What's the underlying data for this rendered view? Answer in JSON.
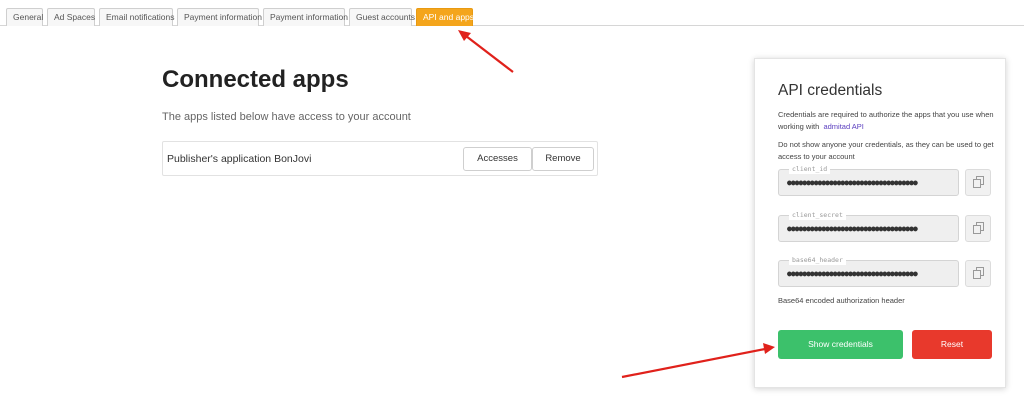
{
  "tabs": [
    {
      "label": "General",
      "active": false
    },
    {
      "label": "Ad Spaces",
      "active": false
    },
    {
      "label": "Email notifications",
      "active": false
    },
    {
      "label": "Payment information",
      "active": false
    },
    {
      "label": "Payment information",
      "active": false
    },
    {
      "label": "Guest accounts",
      "active": false
    },
    {
      "label": "API and apps",
      "active": true
    }
  ],
  "connected_apps": {
    "title": "Connected apps",
    "subtitle": "The apps listed below have access to your account",
    "app_name": "Publisher's application BonJovi",
    "accesses_label": "Accesses",
    "remove_label": "Remove"
  },
  "api_credentials": {
    "title": "API credentials",
    "description": "Credentials are required to authorize the apps that you use when working with",
    "description_link": "admitad API",
    "warning": "Do not show anyone your credentials, as they can be used to get access to your account",
    "fields": [
      {
        "label": "client_id",
        "value": "●●●●●●●●●●●●●●●●●●●●●●●●●●●●●●●●●●"
      },
      {
        "label": "client_secret",
        "value": "●●●●●●●●●●●●●●●●●●●●●●●●●●●●●●●●●●"
      },
      {
        "label": "base64_header",
        "value": "●●●●●●●●●●●●●●●●●●●●●●●●●●●●●●●●●●"
      }
    ],
    "note": "Base64 encoded authorization header",
    "show_label": "Show credentials",
    "reset_label": "Reset"
  },
  "colors": {
    "active_tab": "#f4a51c",
    "show_button": "#3cc16b",
    "reset_button": "#e8392c",
    "link": "#5b3fbf",
    "annotation_arrow": "#e0211b"
  },
  "icons": [
    "copy-icon",
    "arrow-annotation"
  ]
}
